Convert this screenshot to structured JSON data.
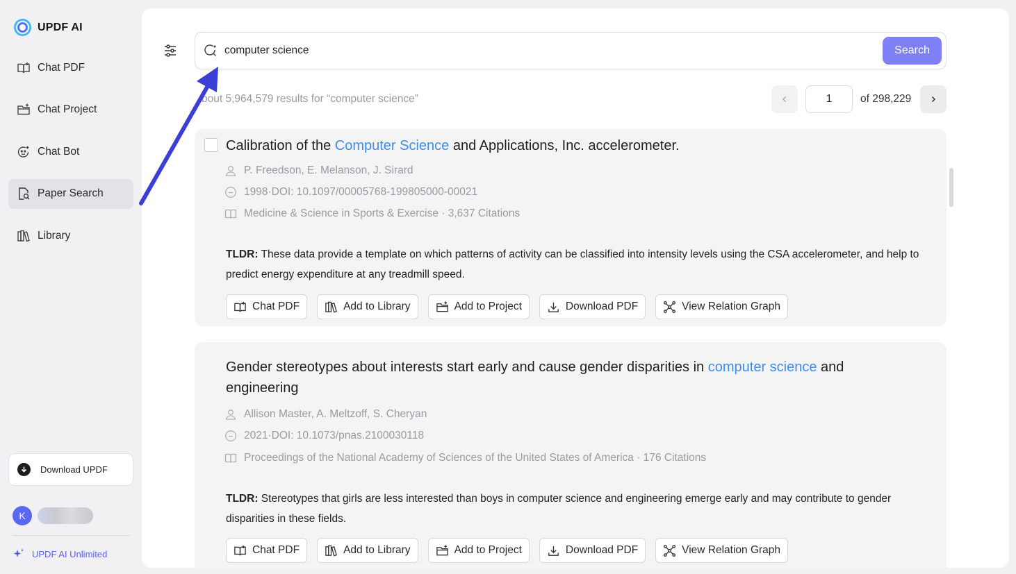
{
  "app": {
    "name": "UPDF AI"
  },
  "sidebar": {
    "items": [
      {
        "label": "Chat PDF",
        "icon": "book-open-icon"
      },
      {
        "label": "Chat Project",
        "icon": "folder-plus-icon"
      },
      {
        "label": "Chat Bot",
        "icon": "bot-icon"
      },
      {
        "label": "Paper Search",
        "icon": "paper-search-icon",
        "active": true
      },
      {
        "label": "Library",
        "icon": "library-icon"
      }
    ],
    "download_label": "Download UPDF",
    "avatar_initial": "K",
    "unlimited_label": "UPDF AI Unlimited"
  },
  "search": {
    "value": "computer science",
    "button_label": "Search",
    "results_text": "bout 5,964,579 results for “computer science”"
  },
  "pager": {
    "current": "1",
    "total_text": "of 298,229"
  },
  "results": [
    {
      "title_pre": "Calibration of the ",
      "title_hl": "Computer Science",
      "title_post": " and Applications, Inc. accelerometer.",
      "authors": "P. Freedson,  E. Melanson,  J. Sirard",
      "date_doi": "1998·DOI: 10.1097/00005768-199805000-00021",
      "venue": "Medicine & Science in Sports & Exercise · 3,637 Citations",
      "tldr_label": "TLDR:",
      "tldr": " These data provide a template on which patterns of activity can be classified into intensity levels using the CSA accelerometer, and help to predict energy expenditure at any treadmill speed."
    },
    {
      "title_pre": "Gender stereotypes about interests start early and cause gender disparities in ",
      "title_hl": "computer science",
      "title_post": " and engineering",
      "authors": "Allison Master,  A. Meltzoff,  S. Cheryan",
      "date_doi": "2021·DOI: 10.1073/pnas.2100030118",
      "venue": "Proceedings of the National Academy of Sciences of the United States of America · 176 Citations",
      "tldr_label": "TLDR:",
      "tldr": " Stereotypes that girls are less interested than boys in computer science and engineering emerge early and may contribute to gender disparities in these fields."
    }
  ],
  "actions": {
    "chat_pdf": "Chat PDF",
    "add_library": "Add to Library",
    "add_project": "Add to Project",
    "download_pdf": "Download PDF",
    "relation_graph": "View Relation Graph"
  },
  "colors": {
    "accent": "#7f7ff6",
    "highlight": "#3d8ef0",
    "arrow": "#3b3fd4"
  }
}
